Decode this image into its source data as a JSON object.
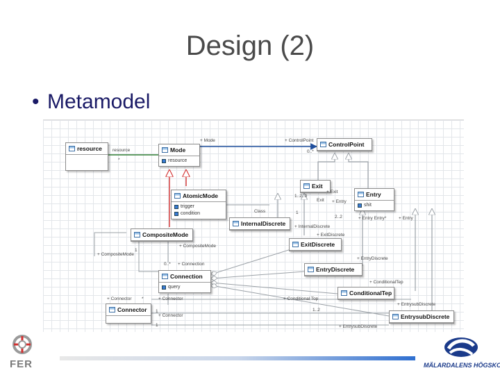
{
  "slide": {
    "title": "Design (2)",
    "bullet": "Metamodel",
    "bullet_symbol": "•"
  },
  "diagram": {
    "classes": {
      "resource": {
        "name": "resource"
      },
      "mode": {
        "name": "Mode",
        "attrs": [
          "resource"
        ]
      },
      "control_point": {
        "name": "ControlPoint"
      },
      "exit": {
        "name": "Exit"
      },
      "entry": {
        "name": "Entry",
        "attrs": [
          "shit"
        ]
      },
      "atomic_mode": {
        "name": "AtomicMode",
        "attrs": [
          "trigger",
          "condition"
        ]
      },
      "internal_discrete": {
        "name": "InternalDiscrete"
      },
      "composite_mode": {
        "name": "CompositeMode"
      },
      "exit_discrete": {
        "name": "ExitDiscrete"
      },
      "entry_discrete": {
        "name": "EntryDiscrete"
      },
      "connection": {
        "name": "Connection",
        "attrs": [
          "query"
        ]
      },
      "conditional_tep": {
        "name": "ConditionalTep"
      },
      "connector": {
        "name": "Connector"
      },
      "entry_sub_discrete": {
        "name": "EntrysubDiscrete"
      }
    },
    "labels": {
      "mode_cp": "+ Mode",
      "cp_role": "+ ControlPoint",
      "res_role": "resource",
      "res_mult": "*",
      "cp_mult": "0..*",
      "exit_role": "+ Exit",
      "exit_mult": "1..2..0",
      "exit_role2": "Exit",
      "entry_role": "+ Entry",
      "entry_mult": "2..2",
      "entry_role2": "+ Entry Entry*",
      "entry_role3": "+ Entry",
      "class_role": "Class",
      "one_a": "1",
      "internal_discrete_role": "+ InternalDiscrete",
      "exit_discrete_role": "+ ExitDiscrete",
      "composite_child": "+ CompositeMode",
      "composite_child2": "+ CompositeMode",
      "one_b": "1",
      "connection_mult": "0..*",
      "connection_role": "+ Connection",
      "entry_discrete_role": "+ EntryDiscrete",
      "conditional_role": "+ ConditionalTep",
      "star_a": "*",
      "connector_role": "+ Connector",
      "connector_role2": "+ Connector",
      "conditional_role2": "+ Conditional Top",
      "connector_mult": "1",
      "conditional_mult": "1..2",
      "entry_sub_role": "+ EntrysubDiscrete",
      "entry_sub_role2": "+ EntrysubDiscrete",
      "connector_role3": "+ Connector",
      "one_c": "1"
    }
  },
  "footer": {
    "left_logo_text": "FER",
    "right_logo_text": "MÄLARDALENS HÖGSKOLA"
  },
  "colors": {
    "title": "#4a4a4a",
    "bullet": "#1a1a66",
    "assoc_green": "#2e7d32",
    "assoc_blue": "#1f4e9c",
    "generalization_red": "#d32f2f",
    "generalization_gray": "#9aa0a6"
  }
}
